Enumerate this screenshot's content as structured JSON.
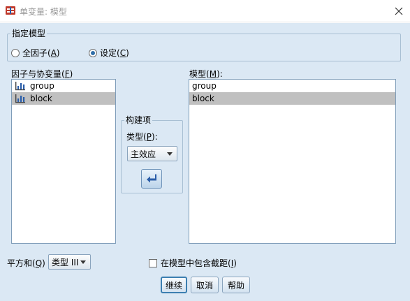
{
  "window": {
    "title": "单变量: 模型",
    "accent_color": "#dbe8f4"
  },
  "specify_model": {
    "legend": "指定模型",
    "full_factorial": {
      "label": "全因子",
      "mnemonic": "A",
      "checked": false
    },
    "custom": {
      "label": "设定",
      "mnemonic": "C",
      "checked": true
    }
  },
  "factors": {
    "label": "因子与协变量",
    "mnemonic": "F",
    "items": [
      {
        "name": "group",
        "icon": "nominal-variable-icon",
        "selected": false
      },
      {
        "name": "block",
        "icon": "nominal-variable-icon",
        "selected": true
      }
    ]
  },
  "build_term": {
    "legend": "构建项",
    "type_label": "类型",
    "type_mnemonic": "P",
    "type_value": "主效应",
    "move_icon": "arrow-left-icon"
  },
  "model": {
    "label": "模型",
    "mnemonic": "M",
    "items": [
      {
        "name": "group",
        "selected": false
      },
      {
        "name": "block",
        "selected": true
      }
    ]
  },
  "sum_of_squares": {
    "label": "平方和",
    "mnemonic": "Q",
    "value": "类型 III"
  },
  "include_intercept": {
    "label": "在模型中包含截距",
    "mnemonic": "I",
    "checked": false
  },
  "buttons": {
    "continue": "继续",
    "cancel": "取消",
    "help": "帮助"
  }
}
